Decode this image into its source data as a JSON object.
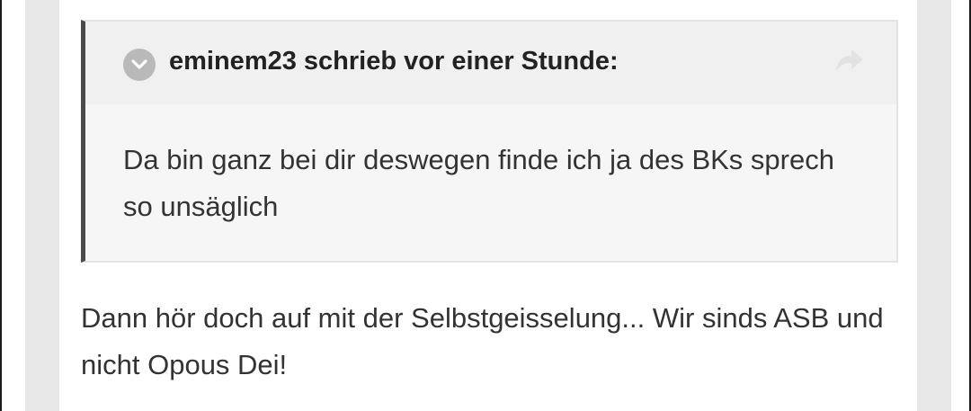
{
  "quote": {
    "author_line": "eminem23 schrieb vor einer Stunde:",
    "body": "Da bin ganz bei dir deswegen finde ich ja des BKs sprech so unsäglich"
  },
  "post": {
    "text": "Dann hör doch auf mit der Selbstgeisselung... Wir sinds ASB und nicht Opous Dei!"
  },
  "icons": {
    "expand": "chevron-down-icon",
    "share": "share-arrow-icon"
  },
  "colors": {
    "quote_border": "#4a4a4a",
    "quote_header_bg": "#f0f0f0",
    "page_bg": "#e8e8e8"
  }
}
